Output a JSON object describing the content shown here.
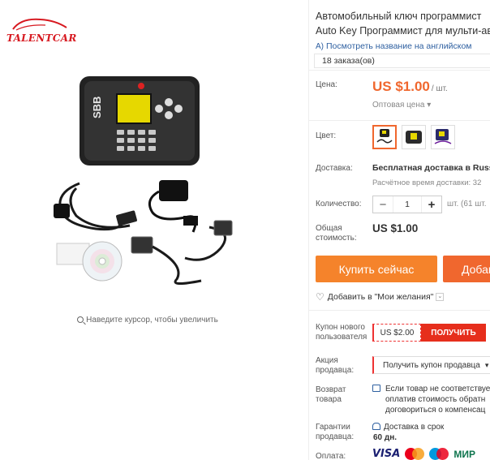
{
  "brand": {
    "logo_text": "TALENTCAR"
  },
  "gallery": {
    "zoom_hint": "Наведите курсор, чтобы увеличить",
    "image_label": "SBB"
  },
  "product": {
    "title_line1": "Автомобильный ключ программист",
    "title_line2": "Auto Key Программист для мульти-ав",
    "translate_link": "Посмотреть название на английском",
    "orders": "18 заказа(ов)"
  },
  "price": {
    "label": "Цена:",
    "value": "US $1.00",
    "unit": "/ шт.",
    "wholesale": "Оптовая цена"
  },
  "color": {
    "label": "Цвет:",
    "options": [
      "swatch-1",
      "swatch-2",
      "swatch-3"
    ],
    "selected_index": 0
  },
  "shipping": {
    "label": "Доставка:",
    "main": "Бесплатная доставка в Russi",
    "sub": "Расчётное время доставки: 32"
  },
  "quantity": {
    "label": "Количество:",
    "value": "1",
    "note": "шт. (61 шт."
  },
  "total": {
    "label_line1": "Общая",
    "label_line2": "стоимость:",
    "value": "US $1.00"
  },
  "actions": {
    "buy_now": "Купить сейчас",
    "add_to_cart": "Добав"
  },
  "wishlist": {
    "label": "Добавить в \"Мои желания\""
  },
  "coupon_new": {
    "label_line1": "Купон нового",
    "label_line2": "пользователя",
    "amount": "US $2.00",
    "get": "ПОЛУЧИТЬ"
  },
  "seller_promo": {
    "label_line1": "Акция",
    "label_line2": "продавца:",
    "button": "Получить купон продавца"
  },
  "returns": {
    "label_line1": "Возврат",
    "label_line2": "товара",
    "line1": "Если товар не соответствуе",
    "line2": "оплатив стоимость обратн",
    "line3": "договориться о компенсац"
  },
  "guarantees": {
    "label_line1": "Гарантии",
    "label_line2": "продавца:",
    "line1": "Доставка в срок",
    "line2": "60 дн."
  },
  "payment": {
    "label": "Оплата:",
    "methods": [
      "VISA",
      "Maestro",
      "МИР"
    ]
  },
  "colors": {
    "accent": "#f0672e",
    "buy": "#f5832b",
    "red": "#e62e1c",
    "link": "#2d5fa0"
  }
}
